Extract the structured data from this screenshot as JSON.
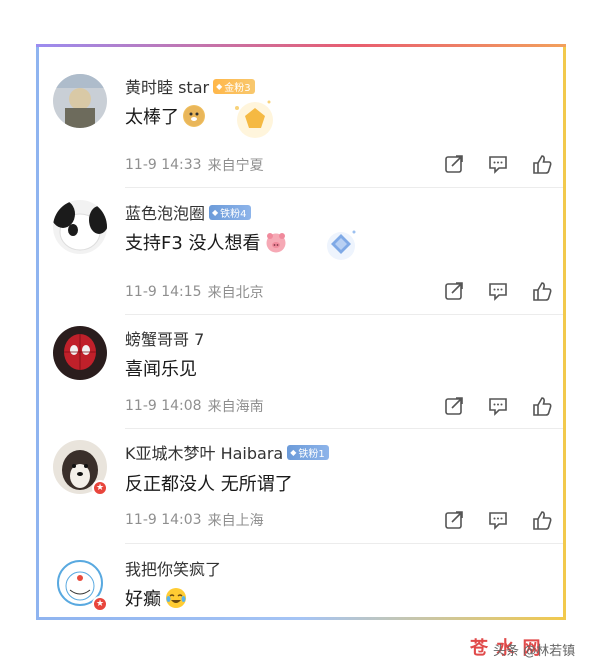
{
  "comments": [
    {
      "username": "黄时睦 star",
      "badge": {
        "type": "gold",
        "text": "金粉3"
      },
      "text": "太棒了",
      "emoji": "doge-emoji",
      "time": "11-9 14:33",
      "location": "来自宁夏"
    },
    {
      "username": "蓝色泡泡圈",
      "badge": {
        "type": "iron",
        "text": "铁粉4"
      },
      "text": "支持F3 没人想看",
      "emoji": "pig-emoji",
      "time": "11-9 14:15",
      "location": "来自北京"
    },
    {
      "username": "螃蟹哥哥 7",
      "badge": null,
      "text": "喜闻乐见",
      "time": "11-9 14:08",
      "location": "来自海南"
    },
    {
      "username": "K亚城木梦叶 Haibara",
      "badge": {
        "type": "iron",
        "text": "铁粉1"
      },
      "text": "反正都没人 无所谓了",
      "time": "11-9 14:03",
      "location": "来自上海"
    },
    {
      "username": "我把你笑疯了",
      "badge": null,
      "text": "好癫",
      "emoji": "laugh-cry-emoji"
    }
  ],
  "icons": {
    "share": "share-icon",
    "comment": "comment-icon",
    "like": "thumbs-up-icon"
  },
  "watermark": {
    "brand": "苍 水 网",
    "label": "头条 @林若镇"
  },
  "colors": {
    "frame_top": "#e85d6f",
    "frame_left": "#8fb4f0",
    "frame_right": "#f2c94c",
    "badge_gold": "#ffb74a",
    "badge_iron": "#6c9bd9",
    "meta_text": "#8f8f8f"
  }
}
